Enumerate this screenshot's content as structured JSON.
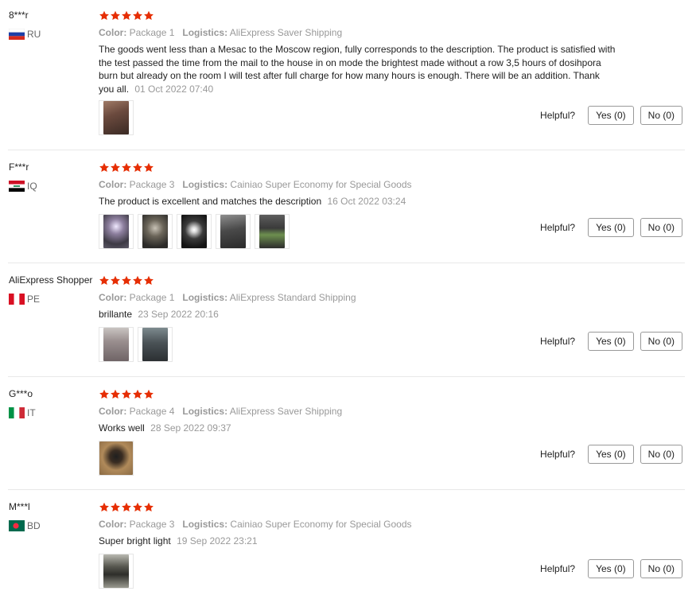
{
  "labels": {
    "color": "Color:",
    "logistics": "Logistics:",
    "helpful": "Helpful?",
    "yes": "Yes (0)",
    "no": "No (0)"
  },
  "colors": {
    "star": "#e62e04",
    "accent_text": "#999999"
  },
  "reviews": [
    {
      "user": "8***r",
      "country": "RU",
      "rating": 5,
      "color": "Package 1",
      "logistics": "AliExpress Saver Shipping",
      "text": "The goods went less than a Mesac to the Moscow region, fully corresponds to the description. The product is satisfied with the test passed the time from the mail to the house in on mode the brightest made without a row 3,5 hours of dosihpora burn but already on the room I will test after full charge for how many hours is enough. There will be an addition. Thank you all.",
      "date": "01 Oct 2022 07:40",
      "photos": 1
    },
    {
      "user": "F***r",
      "country": "IQ",
      "rating": 5,
      "color": "Package 3",
      "logistics": "Cainiao Super Economy for Special Goods",
      "text": "The product is excellent and matches the description",
      "date": "16 Oct 2022 03:24",
      "photos": 5
    },
    {
      "user": "AliExpress Shopper",
      "country": "PE",
      "rating": 5,
      "color": "Package 1",
      "logistics": "AliExpress Standard Shipping",
      "text": "brillante",
      "date": "23 Sep 2022 20:16",
      "photos": 2
    },
    {
      "user": "G***o",
      "country": "IT",
      "rating": 5,
      "color": "Package 4",
      "logistics": "AliExpress Saver Shipping",
      "text": "Works well",
      "date": "28 Sep 2022 09:37",
      "photos": 1
    },
    {
      "user": "M***l",
      "country": "BD",
      "rating": 5,
      "color": "Package 3",
      "logistics": "Cainiao Super Economy for Special Goods",
      "text": "Super bright light",
      "date": "19 Sep 2022 23:21",
      "photos": 1
    }
  ]
}
